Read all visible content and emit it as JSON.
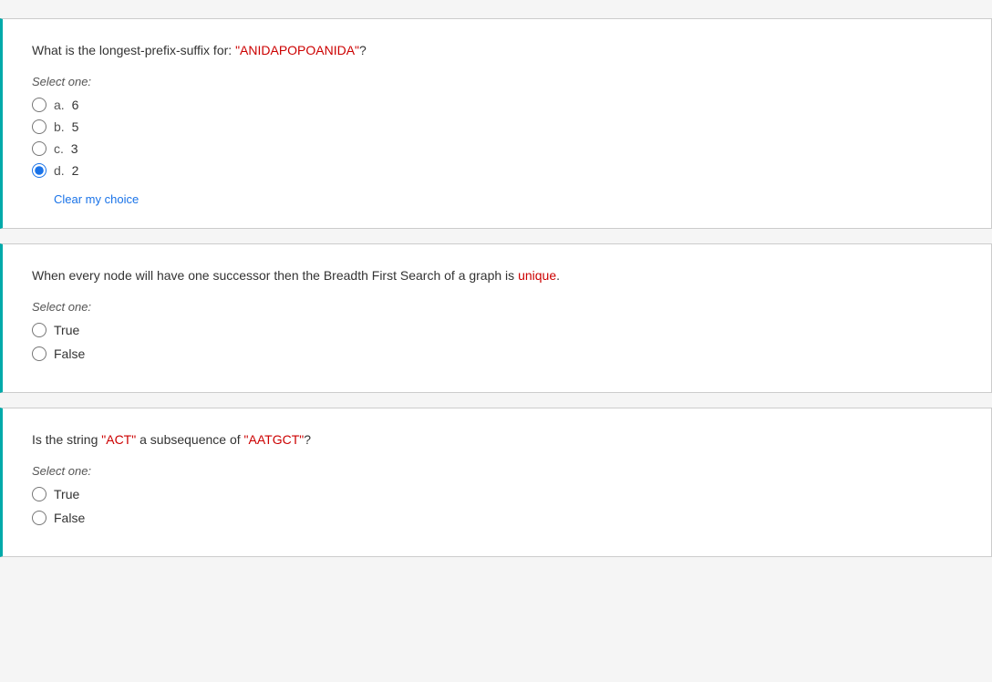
{
  "questions": [
    {
      "id": "q1",
      "text_before": "What is the longest-prefix-suffix for: ",
      "text_highlight": "\"ANIDAPOPOANIDA\"",
      "text_after": "?",
      "select_one_label": "Select one:",
      "type": "multiple_choice",
      "options": [
        {
          "letter": "a.",
          "value": "6",
          "selected": false
        },
        {
          "letter": "b.",
          "value": "5",
          "selected": false
        },
        {
          "letter": "c.",
          "value": "3",
          "selected": false
        },
        {
          "letter": "d.",
          "value": "2",
          "selected": true
        }
      ],
      "clear_label": "Clear my choice",
      "has_selection": true
    },
    {
      "id": "q2",
      "text_before": "When every node will have one successor then the Breadth First Search of a graph is ",
      "text_highlight": "unique",
      "text_after": ".",
      "select_one_label": "Select one:",
      "type": "true_false",
      "options": [
        {
          "value": "True",
          "selected": false
        },
        {
          "value": "False",
          "selected": false
        }
      ],
      "has_selection": false
    },
    {
      "id": "q3",
      "text_before": "Is the string ",
      "text_highlight1": "\"ACT\"",
      "text_middle": " a subsequence of ",
      "text_highlight2": "\"AATGCT\"",
      "text_after": "?",
      "select_one_label": "Select one:",
      "type": "true_false",
      "options": [
        {
          "value": "True",
          "selected": false
        },
        {
          "value": "False",
          "selected": false
        }
      ],
      "has_selection": false
    }
  ]
}
